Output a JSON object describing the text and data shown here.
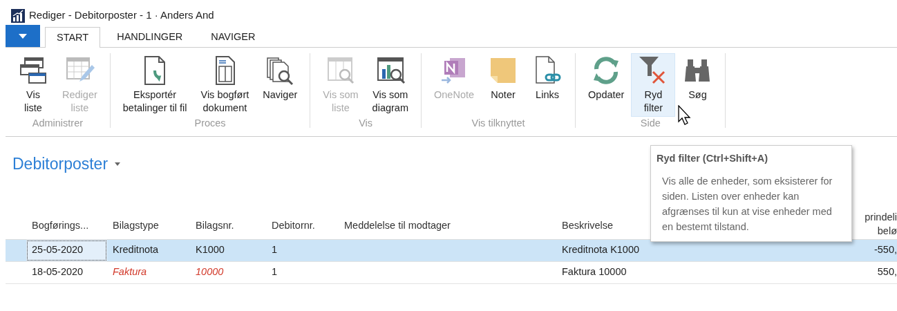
{
  "window": {
    "title": "Rediger - Debitorposter - 1 · Anders And"
  },
  "tabs": [
    {
      "label": "START",
      "selected": true
    },
    {
      "label": "HANDLINGER",
      "selected": false
    },
    {
      "label": "NAVIGER",
      "selected": false
    }
  ],
  "ribbon": {
    "groups": [
      {
        "label": "Administrer",
        "buttons": [
          {
            "label": "Vis\nliste",
            "disabled": false,
            "hovered": false
          },
          {
            "label": "Rediger\nliste",
            "disabled": true,
            "hovered": false
          }
        ]
      },
      {
        "label": "Proces",
        "buttons": [
          {
            "label": "Eksportér\nbetalinger til fil",
            "disabled": false,
            "hovered": false
          },
          {
            "label": "Vis bogført\ndokument",
            "disabled": false,
            "hovered": false
          },
          {
            "label": "Naviger",
            "disabled": false,
            "hovered": false
          }
        ]
      },
      {
        "label": "Vis",
        "buttons": [
          {
            "label": "Vis som\nliste",
            "disabled": true,
            "hovered": false
          },
          {
            "label": "Vis som\ndiagram",
            "disabled": false,
            "hovered": false
          }
        ]
      },
      {
        "label": "Vis tilknyttet",
        "buttons": [
          {
            "label": "OneNote",
            "disabled": true,
            "hovered": false
          },
          {
            "label": "Noter",
            "disabled": false,
            "hovered": false
          },
          {
            "label": "Links",
            "disabled": false,
            "hovered": false
          }
        ]
      },
      {
        "label": "Side",
        "buttons": [
          {
            "label": "Opdater",
            "disabled": false,
            "hovered": false
          },
          {
            "label": "Ryd\nfilter",
            "disabled": false,
            "hovered": true
          },
          {
            "label": "Søg",
            "disabled": false,
            "hovered": false
          }
        ]
      }
    ]
  },
  "list": {
    "title": "Debitorposter",
    "columns": [
      "Bogførings...",
      "Bilagstype",
      "Bilagsnr.",
      "Debitornr.",
      "Meddelelse til modtager",
      "Beskrivelse",
      "prindeli\nbelø"
    ],
    "rows": [
      {
        "selected": true,
        "overdue": false,
        "cells": [
          "25-05-2020",
          "Kreditnota",
          "K1000",
          "1",
          "",
          "Kreditnota K1000",
          "-550,"
        ]
      },
      {
        "selected": false,
        "overdue": true,
        "cells": [
          "18-05-2020",
          "Faktura",
          "10000",
          "1",
          "",
          "Faktura 10000",
          "550,"
        ]
      }
    ]
  },
  "tooltip": {
    "title": "Ryd filter (Ctrl+Shift+A)",
    "text": "Vis alle de enheder, som eksisterer for siden. Listen over enheder kan afgrænses til kun at vise enheder med en bestemt tilstand."
  }
}
